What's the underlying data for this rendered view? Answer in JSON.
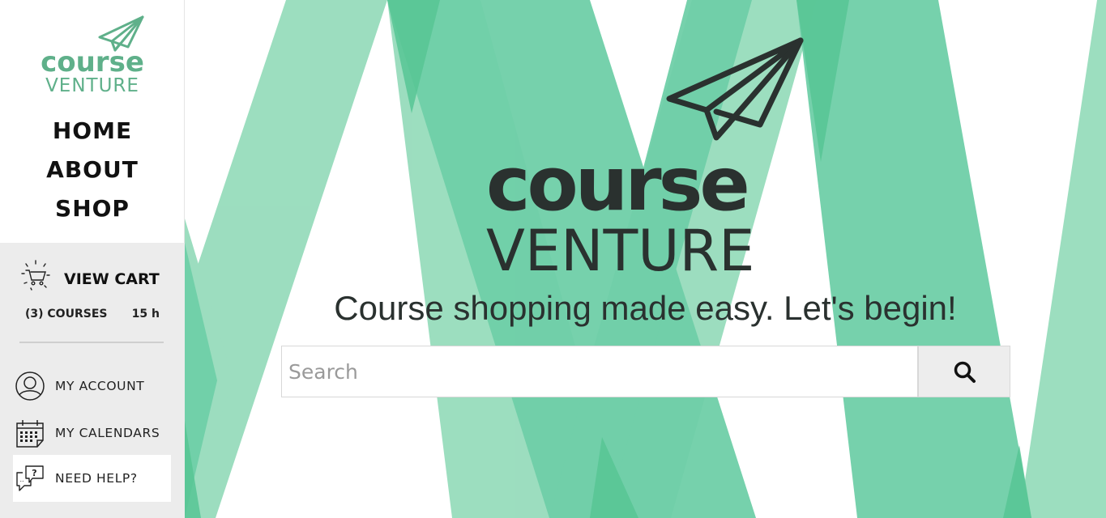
{
  "sidebar": {
    "logo": {
      "word1": "course",
      "word2": "VENTURE"
    },
    "nav": [
      {
        "label": "HOME"
      },
      {
        "label": "ABOUT"
      },
      {
        "label": "SHOP"
      }
    ],
    "cart": {
      "label": "VIEW CART",
      "courses": "(3) COURSES",
      "hours": "15 h"
    },
    "menu": [
      {
        "label": "MY ACCOUNT",
        "icon": "user-circle-icon"
      },
      {
        "label": "MY CALENDARS",
        "icon": "calendar-icon"
      },
      {
        "label": "NEED HELP?",
        "icon": "chat-question-icon"
      }
    ]
  },
  "hero": {
    "logo": {
      "word1": "course",
      "word2": "VENTURE"
    },
    "tagline": "Course shopping made easy. Let's begin!",
    "search": {
      "placeholder": "Search",
      "value": ""
    }
  },
  "colors": {
    "accent": "#5fb08a",
    "stripe_light": "#97dcbc",
    "stripe_mid": "#6fcfa8",
    "stripe_dark": "#57c594",
    "text_dark": "#2a312f"
  }
}
